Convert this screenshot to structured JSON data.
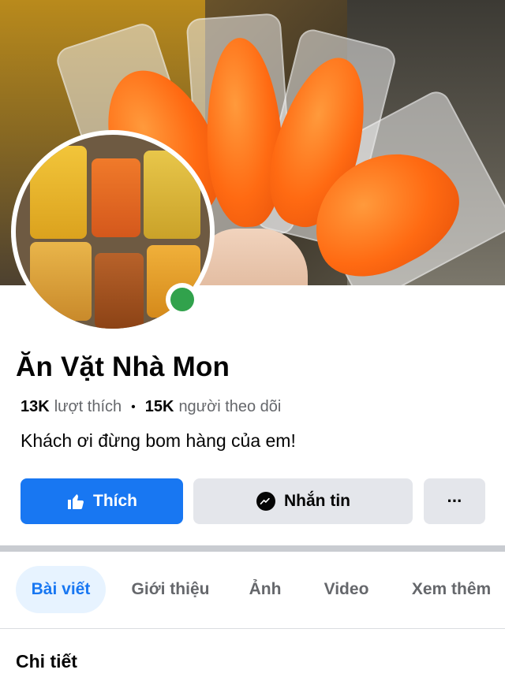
{
  "page": {
    "name": "Ăn Vặt Nhà Mon",
    "likes_count": "13K",
    "likes_label": "lượt thích",
    "separator": "•",
    "followers_count": "15K",
    "followers_label": "người theo dõi",
    "bio": "Khách ơi đừng bom hàng của em!",
    "online_status": "online"
  },
  "actions": {
    "like_label": "Thích",
    "message_label": "Nhắn tin",
    "more_label": "···"
  },
  "tabs": [
    {
      "label": "Bài viết",
      "active": true
    },
    {
      "label": "Giới thiệu",
      "active": false
    },
    {
      "label": "Ảnh",
      "active": false
    },
    {
      "label": "Video",
      "active": false
    },
    {
      "label": "Xem thêm",
      "active": false
    }
  ],
  "section": {
    "title": "Chi tiết"
  },
  "colors": {
    "accent": "#1877f2",
    "online": "#31a24c",
    "secondary_button": "#e4e6eb",
    "muted_text": "#65676b"
  },
  "icons": {
    "like": "thumbs-up-icon",
    "message": "messenger-icon",
    "more": "ellipsis-icon"
  }
}
